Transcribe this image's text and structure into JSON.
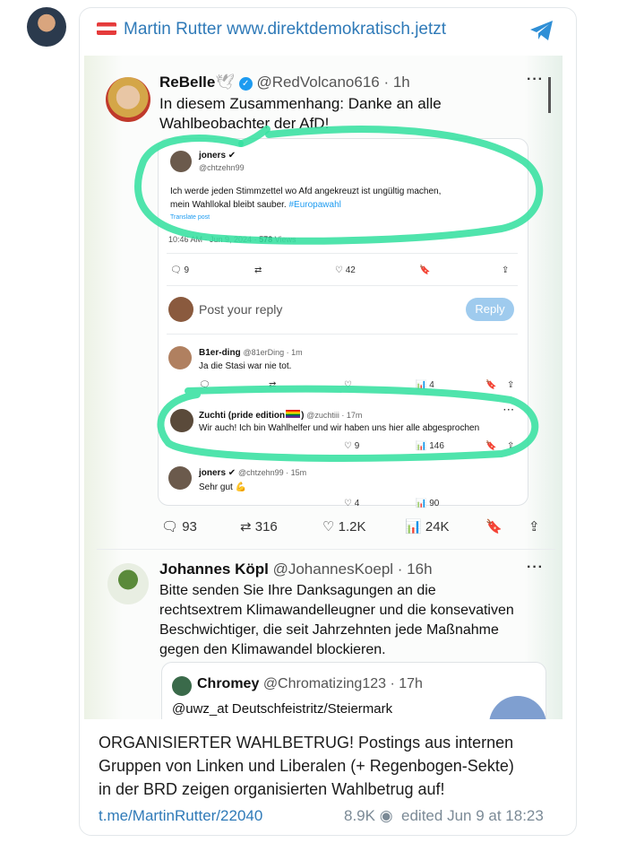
{
  "channel": {
    "title": "Martin Rutter www.direktdemokratisch.jetzt",
    "flag_colors": [
      "#e53b3b",
      "#ffffff"
    ],
    "icon": "telegram-icon"
  },
  "tweet": {
    "name": "ReBelle",
    "handle": "@RedVolcano616 · 1h",
    "text_line1": "In diesem Zusammenhang: Danke an alle",
    "text_line2": "Wahlbeobachter der AfD!",
    "more": "···"
  },
  "inner_post": {
    "name": "joners",
    "handle": "@chtzehn99",
    "text_line1": "Ich werde jeden Stimmzettel wo Afd angekreuzt ist ungültig machen,",
    "text_line2": "mein Wahllokal bleibt sauber.",
    "hashtag": "#Europawahl",
    "translate": "Translate post",
    "time": "10:46 AM · Jun 9, 2024 ·",
    "views_count": "578",
    "views_label": "Views",
    "replies": "9",
    "likes": "42",
    "reply_placeholder": "Post your reply",
    "reply_button": "Reply"
  },
  "replies": [
    {
      "name": "B1er-ding",
      "handle": "@81erDing · 1m",
      "text": "Ja die Stasi war nie tot.",
      "views": "4"
    },
    {
      "name": "Zuchti (pride edition",
      "handle": "@zuchtiii · 17m",
      "text": "Wir auch! Ich bin Wahlhelfer und wir haben uns hier alle abgesprochen",
      "likes": "9",
      "views": "146"
    },
    {
      "name": "joners",
      "handle": "@chtzehn99 · 15m",
      "text": "Sehr gut",
      "likes": "4",
      "views": "90"
    }
  ],
  "tweet_actions": {
    "replies": "93",
    "retweets": "316",
    "likes": "1.2K",
    "views": "24K"
  },
  "second_tweet": {
    "name": "Johannes Köpl",
    "handle": "@JohannesKoepl · 16h",
    "lines": [
      "Bitte senden Sie Ihre Danksagungen an die",
      "rechtsextrem Klimawandelleugner und die konsevativen",
      "Beschwichtiger, die seit Jahrzehnten jede Maßnahme",
      "gegen den Klimawandel blockieren."
    ],
    "quote_name": "Chromey",
    "quote_handle": "@Chromatizing123 · 17h",
    "quote_text": "@uwz_at Deutschfeistritz/Steiermark"
  },
  "caption_lines": [
    "ORGANISIERTER WAHLBETRUG! Postings aus internen",
    "Gruppen von Linken und Liberalen (+ Regenbogen-Sekte)",
    "in der BRD zeigen organisierten Wahlbetrug auf!"
  ],
  "footer": {
    "link": "t.me/MartinRutter/22040",
    "views": "8.9K",
    "edited": "edited",
    "date": "Jun 9 at 18:23"
  },
  "colors": {
    "link": "#2f7ab8",
    "highlight": "#37e0a0",
    "verified": "#1d9bf0"
  }
}
